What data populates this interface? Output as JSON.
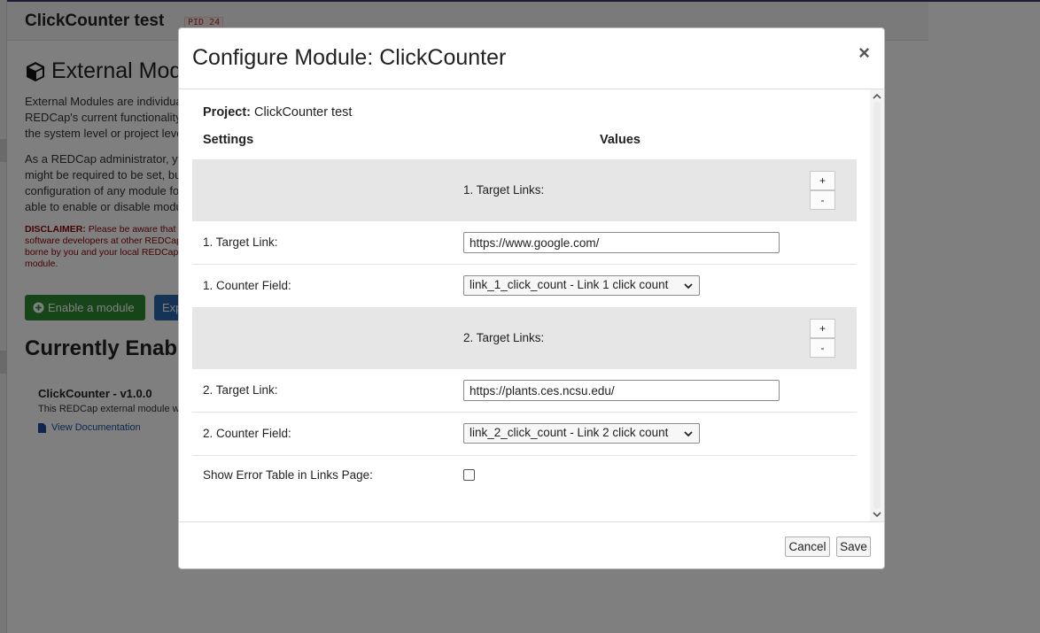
{
  "background": {
    "project_title": "ClickCounter test",
    "pid": "PID 24",
    "heading": "External Modules",
    "intro_lines": [
      "External Modules are individual packages of software that can be downloaded and installed by a REDCap administrator. Modules can extend",
      "REDCap's current functionality, and can also provide customizations and enhancements for REDCap's existing behavior. Modules are enabled at",
      "the system level or project level."
    ],
    "admin_lines": [
      "As a REDCap administrator, you may enable any module for a project. Some modules may have configuration settings that",
      "might be required to be set, but this varies by module. As an administrator, you will be able to view and modify the",
      "configuration of any module for this project. Project users with Project Setup/Design privileges will also be",
      "able to enable or disable modules for this project."
    ],
    "disclaimer_label": "DISCLAIMER:",
    "disclaimer_lines": [
      " Please be aware that External Modules are not part of the REDCap software but instead are add-on packages that have been created by",
      "software developers at other REDCap institutions. Any risks, legal liability, or issues stemming from the use of External Modules must be",
      "borne by you and your local REDCap administrator. Vanderbilt University does not assume any responsibility for the use of any external",
      "module."
    ],
    "enable_button": "Enable a module",
    "export_button": "Export",
    "currently_enabled": "Currently Enabled Modules",
    "module_name": "ClickCounter - v1.0.0",
    "module_desc": "This REDCap external module will count clicks on the links listed in your project configuration.",
    "view_doc": "View Documentation"
  },
  "modal": {
    "title": "Configure Module: ClickCounter",
    "close": "×",
    "project_label": "Project:",
    "project_name": " ClickCounter test",
    "settings_header": "Settings",
    "values_header": "Values",
    "group1_title": "1. Target Links:",
    "group2_title": "2. Target Links:",
    "plus": "+",
    "minus": "-",
    "target_link_1_label": "1. Target Link:",
    "target_link_1_value": "https://www.google.com/",
    "counter_field_1_label": "1. Counter Field:",
    "counter_field_1_value": "link_1_click_count - Link 1 click count",
    "target_link_2_label": "2. Target Link:",
    "target_link_2_value": "https://plants.ces.ncsu.edu/",
    "counter_field_2_label": "2. Counter Field:",
    "counter_field_2_value": "link_2_click_count - Link 2 click count",
    "error_table_label": "Show Error Table in Links Page:",
    "error_table_checked": false,
    "cancel": "Cancel",
    "save": "Save"
  }
}
